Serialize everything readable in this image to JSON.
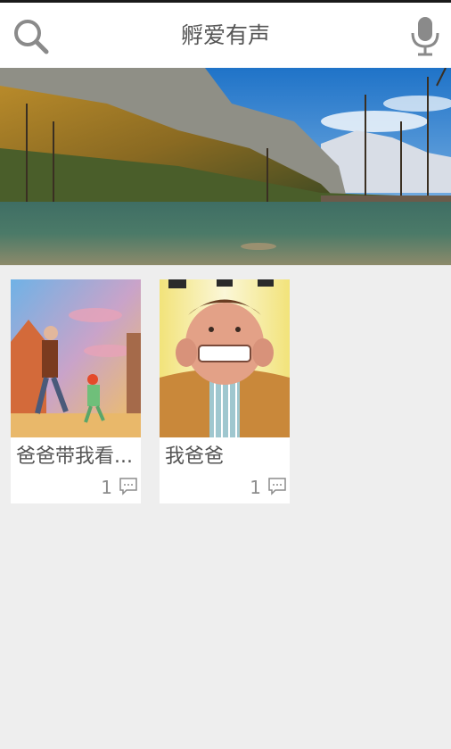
{
  "header": {
    "title": "孵爱有声",
    "search_icon": "search-icon",
    "mic_icon": "microphone-icon"
  },
  "banner": {
    "description_icon": "landscape-banner-image"
  },
  "books": [
    {
      "title": "爸爸带我看...",
      "comments": "1"
    },
    {
      "title": "我爸爸",
      "comments": "1"
    }
  ],
  "colors": {
    "background": "#eeeeee",
    "header": "#ffffff",
    "text": "#555555"
  }
}
